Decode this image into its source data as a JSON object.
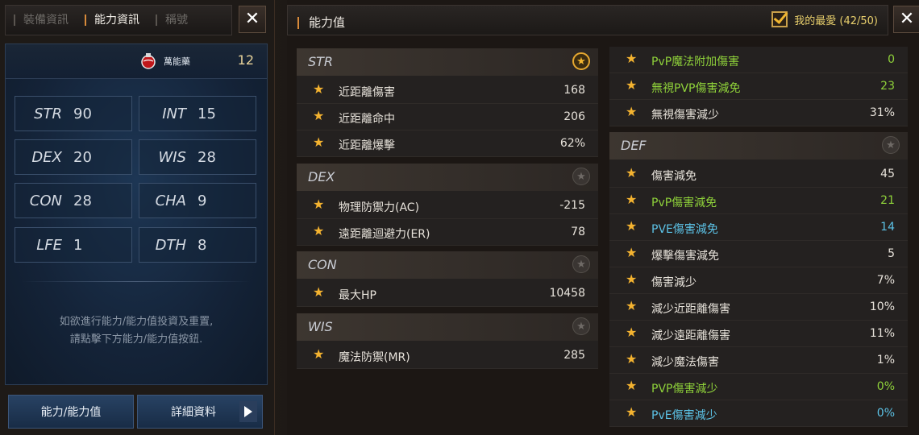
{
  "left": {
    "tabs": [
      "裝備資訊",
      "能力資訊",
      "稱號"
    ],
    "potion_label": "萬能藥",
    "potion_count": "12",
    "stats": [
      {
        "name": "STR",
        "value": "90"
      },
      {
        "name": "INT",
        "value": "15"
      },
      {
        "name": "DEX",
        "value": "20"
      },
      {
        "name": "WIS",
        "value": "28"
      },
      {
        "name": "CON",
        "value": "28"
      },
      {
        "name": "CHA",
        "value": "9"
      },
      {
        "name": "LFE",
        "value": "1"
      },
      {
        "name": "DTH",
        "value": "8"
      }
    ],
    "notice_line1": "如欲進行能力/能力值投資及重置,",
    "notice_line2": "請點擊下方能力/能力值按鈕.",
    "btn_ability": "能力/能力值",
    "btn_detail": "詳細資料"
  },
  "right": {
    "title": "能力值",
    "favorite": "我的最愛 (42/50)",
    "groups": [
      {
        "name": "STR",
        "fav": true,
        "rows": [
          {
            "label": "近距離傷害",
            "value": "168",
            "color": "white"
          },
          {
            "label": "近距離命中",
            "value": "206",
            "color": "white"
          },
          {
            "label": "近距離爆擊",
            "value": "62%",
            "color": "white"
          }
        ]
      },
      {
        "name": "DEX",
        "fav": false,
        "rows": [
          {
            "label": "物理防禦力(AC)",
            "value": "-215",
            "color": "white"
          },
          {
            "label": "遠距離迴避力(ER)",
            "value": "78",
            "color": "white"
          }
        ]
      },
      {
        "name": "CON",
        "fav": false,
        "rows": [
          {
            "label": "最大HP",
            "value": "10458",
            "color": "white"
          }
        ]
      },
      {
        "name": "WIS",
        "fav": false,
        "rows": [
          {
            "label": "魔法防禦(MR)",
            "value": "285",
            "color": "white"
          }
        ]
      },
      {
        "name": "",
        "rows": [
          {
            "label": "PvP魔法附加傷害",
            "value": "0",
            "color": "green"
          },
          {
            "label": "無視PVP傷害減免",
            "value": "23",
            "color": "green"
          },
          {
            "label": "無視傷害減少",
            "value": "31%",
            "color": "white"
          }
        ]
      },
      {
        "name": "DEF",
        "fav": false,
        "rows": [
          {
            "label": "傷害減免",
            "value": "45",
            "color": "white"
          },
          {
            "label": "PvP傷害減免",
            "value": "21",
            "color": "green"
          },
          {
            "label": "PVE傷害減免",
            "value": "14",
            "color": "blue"
          },
          {
            "label": "爆擊傷害減免",
            "value": "5",
            "color": "white"
          },
          {
            "label": "傷害減少",
            "value": "7%",
            "color": "white"
          },
          {
            "label": "減少近距離傷害",
            "value": "10%",
            "color": "white"
          },
          {
            "label": "減少遠距離傷害",
            "value": "11%",
            "color": "white"
          },
          {
            "label": "減少魔法傷害",
            "value": "1%",
            "color": "white"
          },
          {
            "label": "PVP傷害減少",
            "value": "0%",
            "color": "green"
          },
          {
            "label": "PvE傷害減少",
            "value": "0%",
            "color": "blue"
          }
        ]
      }
    ]
  },
  "colors": {
    "star": "#f4b330",
    "green": "#8fd23a",
    "blue": "#5cc2e6",
    "white": "#e7e2da",
    "accent": "#d88a3a"
  },
  "icons": {
    "close": "close-icon",
    "star": "star-icon",
    "potion": "potion-icon",
    "check": "checkbox-check-icon",
    "arrow": "arrow-right-icon"
  }
}
